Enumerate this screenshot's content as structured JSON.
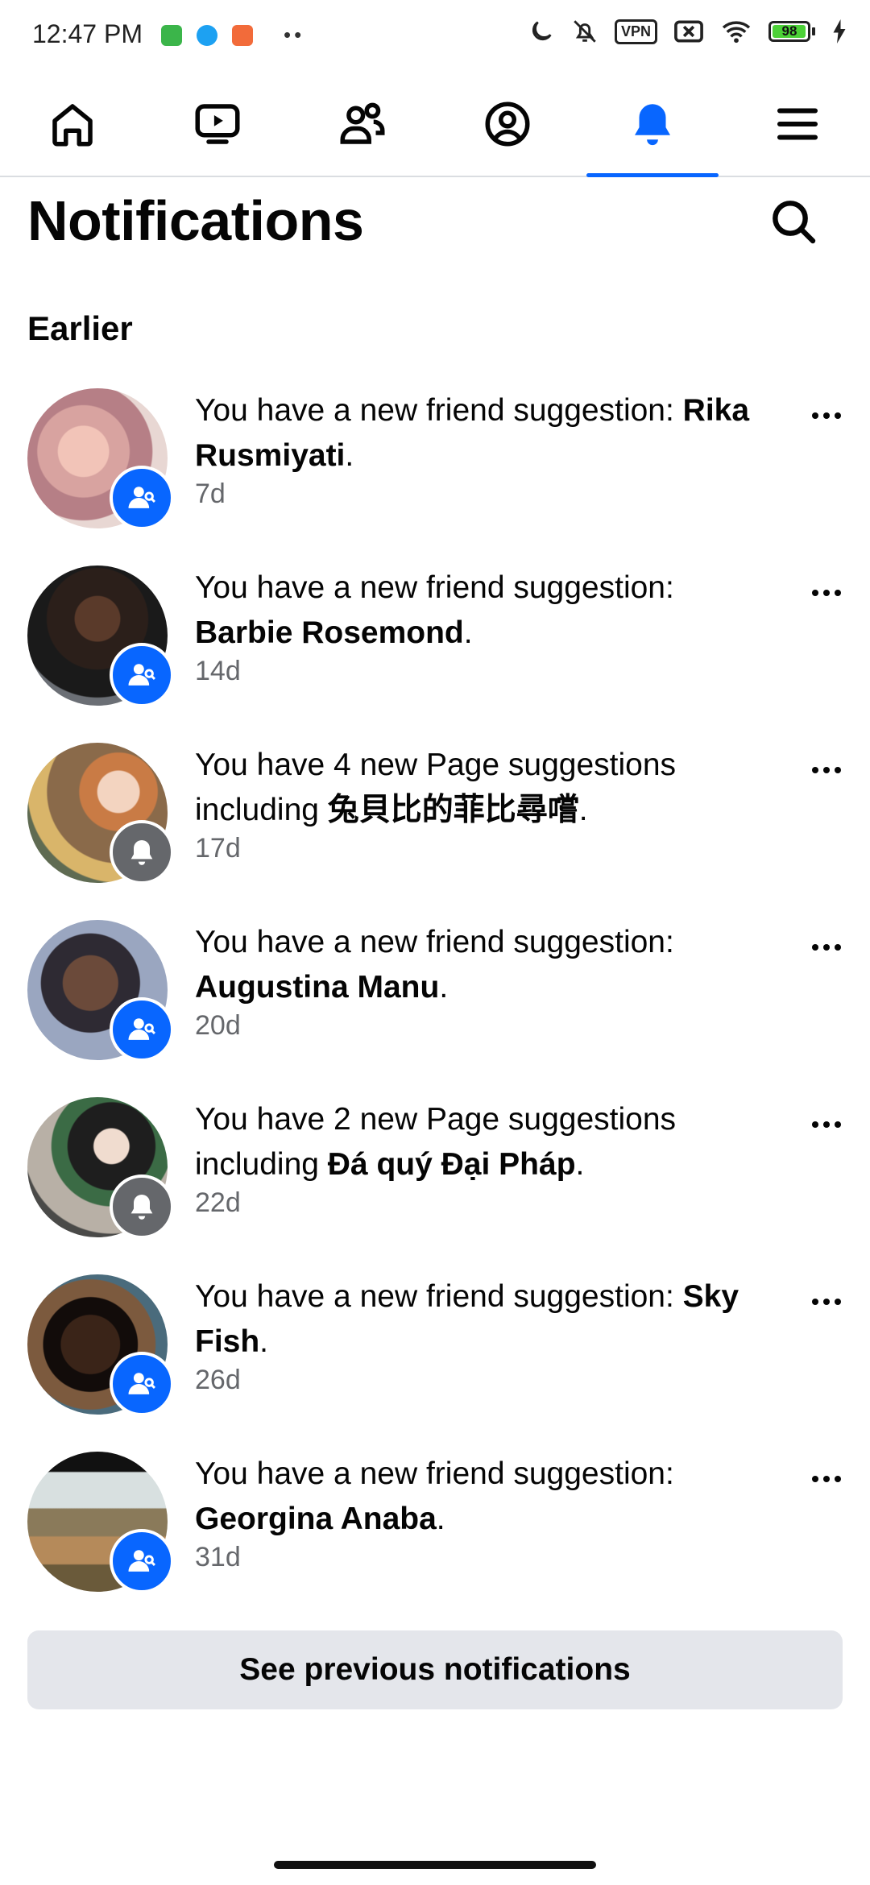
{
  "status_bar": {
    "time": "12:47 PM",
    "vpn": "VPN",
    "battery": "98",
    "battery_level": 0.98
  },
  "nav": {
    "tabs": [
      {
        "icon": "home-icon"
      },
      {
        "icon": "video-icon"
      },
      {
        "icon": "friends-icon"
      },
      {
        "icon": "profile-icon"
      },
      {
        "icon": "bell-icon",
        "active": true
      },
      {
        "icon": "menu-icon"
      }
    ]
  },
  "header": {
    "title": "Notifications",
    "search_icon": "search-icon"
  },
  "section": {
    "title": "Earlier"
  },
  "notifications": [
    {
      "prefix": "You have a new friend suggestion: ",
      "name": "Rika Rusmiyati",
      "suffix": ".",
      "time": "7d",
      "badge": "friend-suggestion-icon"
    },
    {
      "prefix": "You have a new friend suggestion: ",
      "name": "Barbie Rosemond",
      "suffix": ".",
      "time": "14d",
      "badge": "friend-suggestion-icon"
    },
    {
      "prefix": "You have 4 new Page suggestions including ",
      "name": "兔貝比的菲比尋嚐",
      "suffix": ".",
      "time": "17d",
      "badge": "bell-icon"
    },
    {
      "prefix": "You have a new friend suggestion: ",
      "name": "Augustina Manu",
      "suffix": ".",
      "time": "20d",
      "badge": "friend-suggestion-icon"
    },
    {
      "prefix": "You have 2 new Page suggestions including ",
      "name": "Đá quý Đại Pháp",
      "suffix": ".",
      "time": "22d",
      "badge": "bell-icon"
    },
    {
      "prefix": "You have a new friend suggestion: ",
      "name": "Sky Fish",
      "suffix": ".",
      "time": "26d",
      "badge": "friend-suggestion-icon"
    },
    {
      "prefix": "You have a new friend suggestion: ",
      "name": "Georgina Anaba",
      "suffix": ".",
      "time": "31d",
      "badge": "friend-suggestion-icon"
    }
  ],
  "footer": {
    "see_previous": "See previous notifications"
  },
  "colors": {
    "accent": "#0866ff",
    "secondary_text": "#65676b",
    "button_bg": "#e4e6eb"
  }
}
